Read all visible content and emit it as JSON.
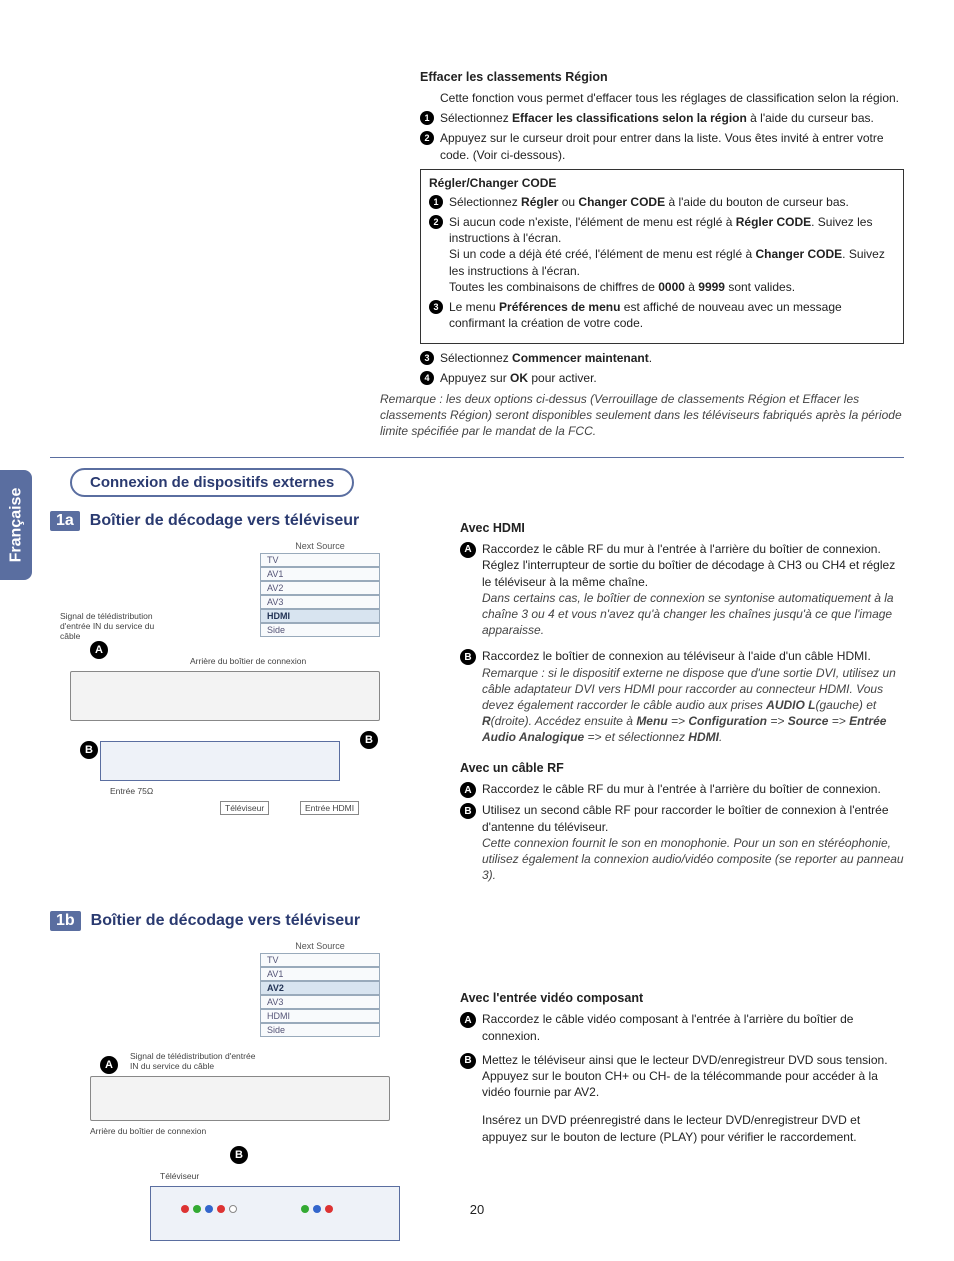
{
  "lang_tab": "Française",
  "top": {
    "heading": "Effacer les classements Région",
    "intro": "Cette fonction vous permet d'effacer tous les réglages de classification selon la région.",
    "step1_pre": "Sélectionnez ",
    "step1_bold": "Effacer les classifications selon la région",
    "step1_post": " à l'aide du curseur bas.",
    "step2": "Appuyez sur le curseur droit pour entrer dans la liste. Vous êtes invité à entrer votre code. (Voir ci-dessous).",
    "box_title": "Régler/Changer CODE",
    "box1_pre": "Sélectionnez ",
    "box1_b1": "Régler",
    "box1_mid": " ou ",
    "box1_b2": "Changer CODE",
    "box1_post": " à l'aide du bouton de curseur bas.",
    "box2a_pre": "Si aucun code n'existe, l'élément de menu est réglé à ",
    "box2a_b": "Régler CODE",
    "box2a_post": ". Suivez les instructions à l'écran.",
    "box2b_pre": "Si un code a déjà été créé, l'élément de menu est réglé à ",
    "box2b_b": "Changer CODE",
    "box2b_post": ". Suivez les instructions à l'écran.",
    "box2c_pre": "Toutes les combinaisons de chiffres de ",
    "box2c_b1": "0000",
    "box2c_mid": " à ",
    "box2c_b2": "9999",
    "box2c_post": " sont valides.",
    "box3_pre": "Le menu ",
    "box3_b": "Préférences de menu",
    "box3_post": " est affiché de nouveau avec un message confirmant la création de votre code.",
    "step3_pre": "Sélectionnez ",
    "step3_b": "Commencer maintenant",
    "step3_post": ".",
    "step4_pre": "Appuyez sur ",
    "step4_b": "OK",
    "step4_post": " pour activer.",
    "remark": "Remarque : les deux options ci-dessus (Verrouillage de classements Région et Effacer les classements Région) seront disponibles seulement dans les téléviseurs fabriqués après la période limite spécifiée par le mandat de la FCC."
  },
  "section_heading": "Connexion de dispositifs externes",
  "sub1a_badge": "1a",
  "sub1a_title": "Boîtier de décodage vers téléviseur",
  "sub1b_badge": "1b",
  "sub1b_title": "Boîtier de décodage vers téléviseur",
  "source_header": "Next Source",
  "sources": [
    "TV",
    "AV1",
    "AV2",
    "AV3",
    "HDMI",
    "Side"
  ],
  "diagram1": {
    "active_index": 4,
    "cap_left": "Signal de télédistribution d'entrée IN du service du câble",
    "cap_back": "Arrière du boîtier de connexion",
    "cap_entry": "Entrée 75Ω",
    "cap_tv": "Téléviseur",
    "cap_hdmi": "Entrée HDMI"
  },
  "diagram2": {
    "active_index": 2,
    "cap_left": "Signal de télédistribution d'entrée IN du service du câble",
    "cap_back": "Arrière du boîtier de connexion",
    "cap_tv": "Téléviseur"
  },
  "hdmi": {
    "heading": "Avec HDMI",
    "A_main": "Raccordez le câble RF du mur à l'entrée à l'arrière du boîtier de connexion. Réglez l'interrupteur de sortie du boîtier de décodage à CH3 ou CH4 et réglez le téléviseur à la même chaîne.",
    "A_note": "Dans certains cas, le boîtier de connexion se syntonise automatiquement à la chaîne 3 ou 4 et vous n'avez qu'à changer les chaînes jusqu'à ce que l'image apparaisse.",
    "B_main": "Raccordez le boîtier de connexion au téléviseur à l'aide d'un câble HDMI.",
    "B_note_pre": "Remarque : si le dispositif externe ne dispose que d'une sortie DVI, utilisez un câble adaptateur DVI vers HDMI pour raccorder au connecteur HDMI. Vous devez également raccorder le câble audio aux prises ",
    "B_note_b1": "AUDIO L",
    "B_note_mid1": "(gauche) et ",
    "B_note_b2": "R",
    "B_note_mid2": "(droite). Accédez ensuite à ",
    "B_note_b3": "Menu",
    "B_note_a1": " => ",
    "B_note_b4": "Configuration",
    "B_note_a2": " => ",
    "B_note_b5": "Source",
    "B_note_a3": " => ",
    "B_note_b6": "Entrée Audio Analogique",
    "B_note_a4": " => et sélectionnez ",
    "B_note_b7": "HDMI",
    "B_note_end": "."
  },
  "rf": {
    "heading": "Avec un câble RF",
    "A": "Raccordez le câble RF du mur à l'entrée à l'arrière du boîtier de connexion.",
    "B_main": "Utilisez un second câble RF pour raccorder le boîtier de connexion à l'entrée d'antenne du téléviseur.",
    "B_note": "Cette connexion fournit le son en monophonie. Pour un son en stéréophonie, utilisez également la connexion audio/vidéo composite (se reporter au panneau 3)."
  },
  "component": {
    "heading": "Avec l'entrée vidéo composant",
    "A": "Raccordez le câble vidéo composant à l'entrée à l'arrière du boîtier de connexion.",
    "B": "Mettez le téléviseur ainsi que le lecteur DVD/enregistreur DVD sous tension. Appuyez sur le bouton CH+ ou CH- de la télécommande pour accéder à la vidéo fournie par AV2.",
    "extra": "Insérez un DVD préenregistré dans le lecteur DVD/enregistreur DVD et appuyez sur le bouton de lecture (PLAY) pour vérifier le raccordement."
  },
  "page_number": "20"
}
